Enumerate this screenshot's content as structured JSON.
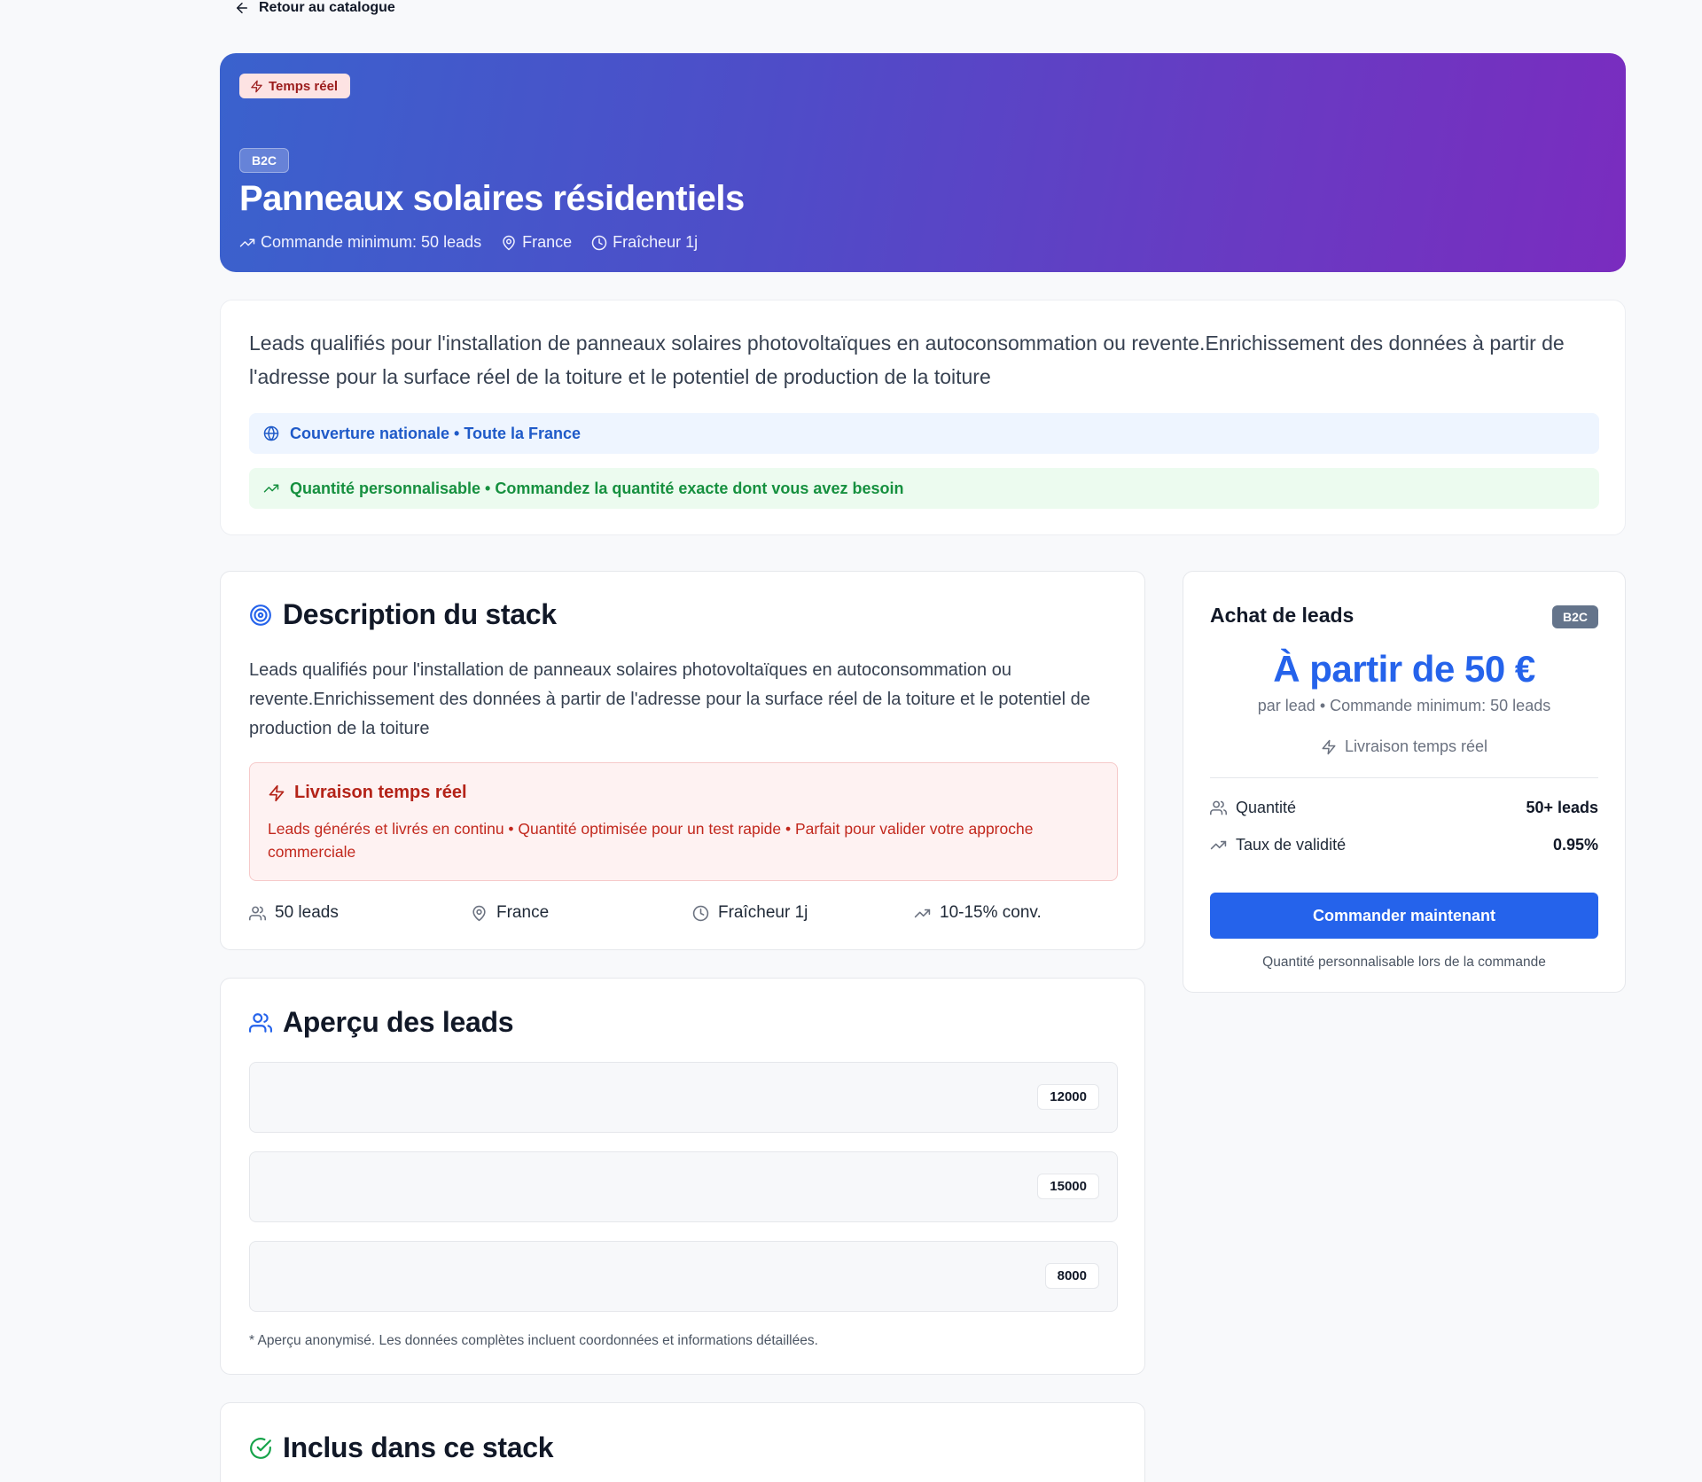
{
  "back": {
    "label": "Retour au catalogue"
  },
  "hero": {
    "badge": "Temps réel",
    "category": "B2C",
    "title": "Panneaux solaires résidentiels",
    "meta": [
      {
        "icon": "trending-up-icon",
        "text": "Commande minimum: 50 leads"
      },
      {
        "icon": "map-pin-icon",
        "text": "France"
      },
      {
        "icon": "clock-icon",
        "text": "Fraîcheur 1j"
      }
    ],
    "colors": {
      "start": "#3a62cd",
      "end": "#7a2cbf"
    }
  },
  "summary": {
    "text": "Leads qualifiés pour l'installation de panneaux solaires photovoltaïques en autoconsommation ou revente.Enrichissement des données à partir de l'adresse pour la surface réel de la toiture et le potentiel de production de la toiture",
    "coverage": "Couverture nationale • Toute la France",
    "quantity": "Quantité personnalisable • Commandez la quantité exacte dont vous avez besoin"
  },
  "stack": {
    "title": "Description du stack",
    "text": "Leads qualifiés pour l'installation de panneaux solaires photovoltaïques en autoconsommation ou revente.Enrichissement des données à partir de l'adresse pour la surface réel de la toiture et le potentiel de production de la toiture",
    "delivery": {
      "title": "Livraison temps réel",
      "text": "Leads générés et livrés en continu • Quantité optimisée pour un test rapide • Parfait pour valider votre approche commerciale"
    },
    "stats": {
      "leads": "50 leads",
      "location": "France",
      "freshness": "Fraîcheur 1j",
      "conversion": "10-15% conv."
    }
  },
  "preview": {
    "title": "Aperçu des leads",
    "rows": [
      "12000",
      "15000",
      "8000"
    ],
    "note": "* Aperçu anonymisé. Les données complètes incluent coordonnées et informations détaillées."
  },
  "included": {
    "title": "Inclus dans ce stack"
  },
  "purchase": {
    "title": "Achat de leads",
    "badge": "B2C",
    "price": "À partir de 50 €",
    "sub": "par lead • Commande minimum: 50 leads",
    "delivery": "Livraison temps réel",
    "quantity_label": "Quantité",
    "quantity_value": "50+ leads",
    "validity_label": "Taux de validité",
    "validity_value": "0.95%",
    "button": "Commander maintenant",
    "note": "Quantité personnalisable lors de la commande",
    "accent": "#2563eb"
  }
}
